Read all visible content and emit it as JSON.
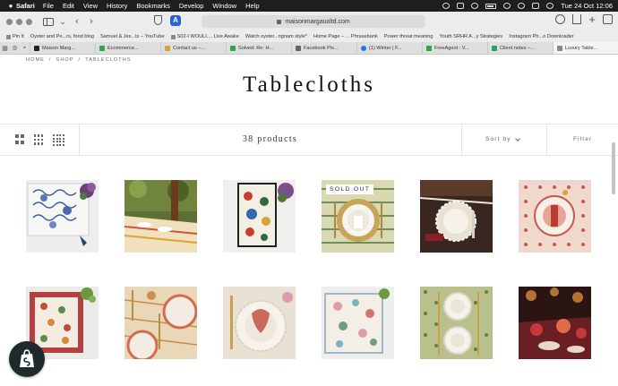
{
  "menubar": {
    "app": "Safari",
    "items": [
      "File",
      "Edit",
      "View",
      "History",
      "Bookmarks",
      "Develop",
      "Window",
      "Help"
    ],
    "datetime": "Tue 24 Oct  12:06"
  },
  "toolbar": {
    "url": "maisonmargauxltd.com"
  },
  "bookmarks": [
    "Pin It",
    "Oyster and Pe...rs, food blog",
    "Samuel & Jes...ts – YouTube",
    "S02-I WOULI.... Live Awake",
    "Watch oyster...ngnam style*",
    "Home Page – ... Phrasebank",
    "Power threat meaning",
    "Youth SRHR A...y Strategies",
    "Instagram Ph...o Downloader"
  ],
  "tabs": [
    {
      "label": "Maison Marg...",
      "color": "#222222"
    },
    {
      "label": "Ecommerce...",
      "color": "#2ca84a"
    },
    {
      "label": "Contact us –...",
      "color": "#d6a23a"
    },
    {
      "label": "Solved: Re: H...",
      "color": "#2ca84a"
    },
    {
      "label": "Facebook Pix...",
      "color": "#666666"
    },
    {
      "label": "(1) Winter | F...",
      "color": "#1877f2"
    },
    {
      "label": "FreeAgent : V...",
      "color": "#2ca84a"
    },
    {
      "label": "Client notes –...",
      "color": "#1fa463"
    },
    {
      "label": "Luxury Table...",
      "color": "#888888"
    }
  ],
  "page": {
    "breadcrumb": [
      "HOME",
      "/",
      "SHOP",
      "/",
      "TABLECLOTHS"
    ],
    "title": "Tablecloths",
    "product_count": "38 products",
    "sort_label": "Sort by",
    "filter_label": "Filter"
  },
  "products": [
    {
      "name": "blue-toile-tablecloth",
      "sold_out": false
    },
    {
      "name": "garden-table-setting",
      "sold_out": false
    },
    {
      "name": "floral-napkin-set",
      "sold_out": false
    },
    {
      "name": "gold-charger-setting",
      "sold_out": true,
      "badge": "SOLD OUT"
    },
    {
      "name": "burgundy-lace-setting",
      "sold_out": false
    },
    {
      "name": "pink-block-print-setting",
      "sold_out": false
    },
    {
      "name": "red-border-tablecloth",
      "sold_out": false
    },
    {
      "name": "coral-plates-setting",
      "sold_out": false
    },
    {
      "name": "scalloped-plate-red-napkin",
      "sold_out": false
    },
    {
      "name": "pastel-floral-napkin",
      "sold_out": false
    },
    {
      "name": "green-print-plates",
      "sold_out": false
    },
    {
      "name": "candlelit-red-table",
      "sold_out": false
    }
  ]
}
